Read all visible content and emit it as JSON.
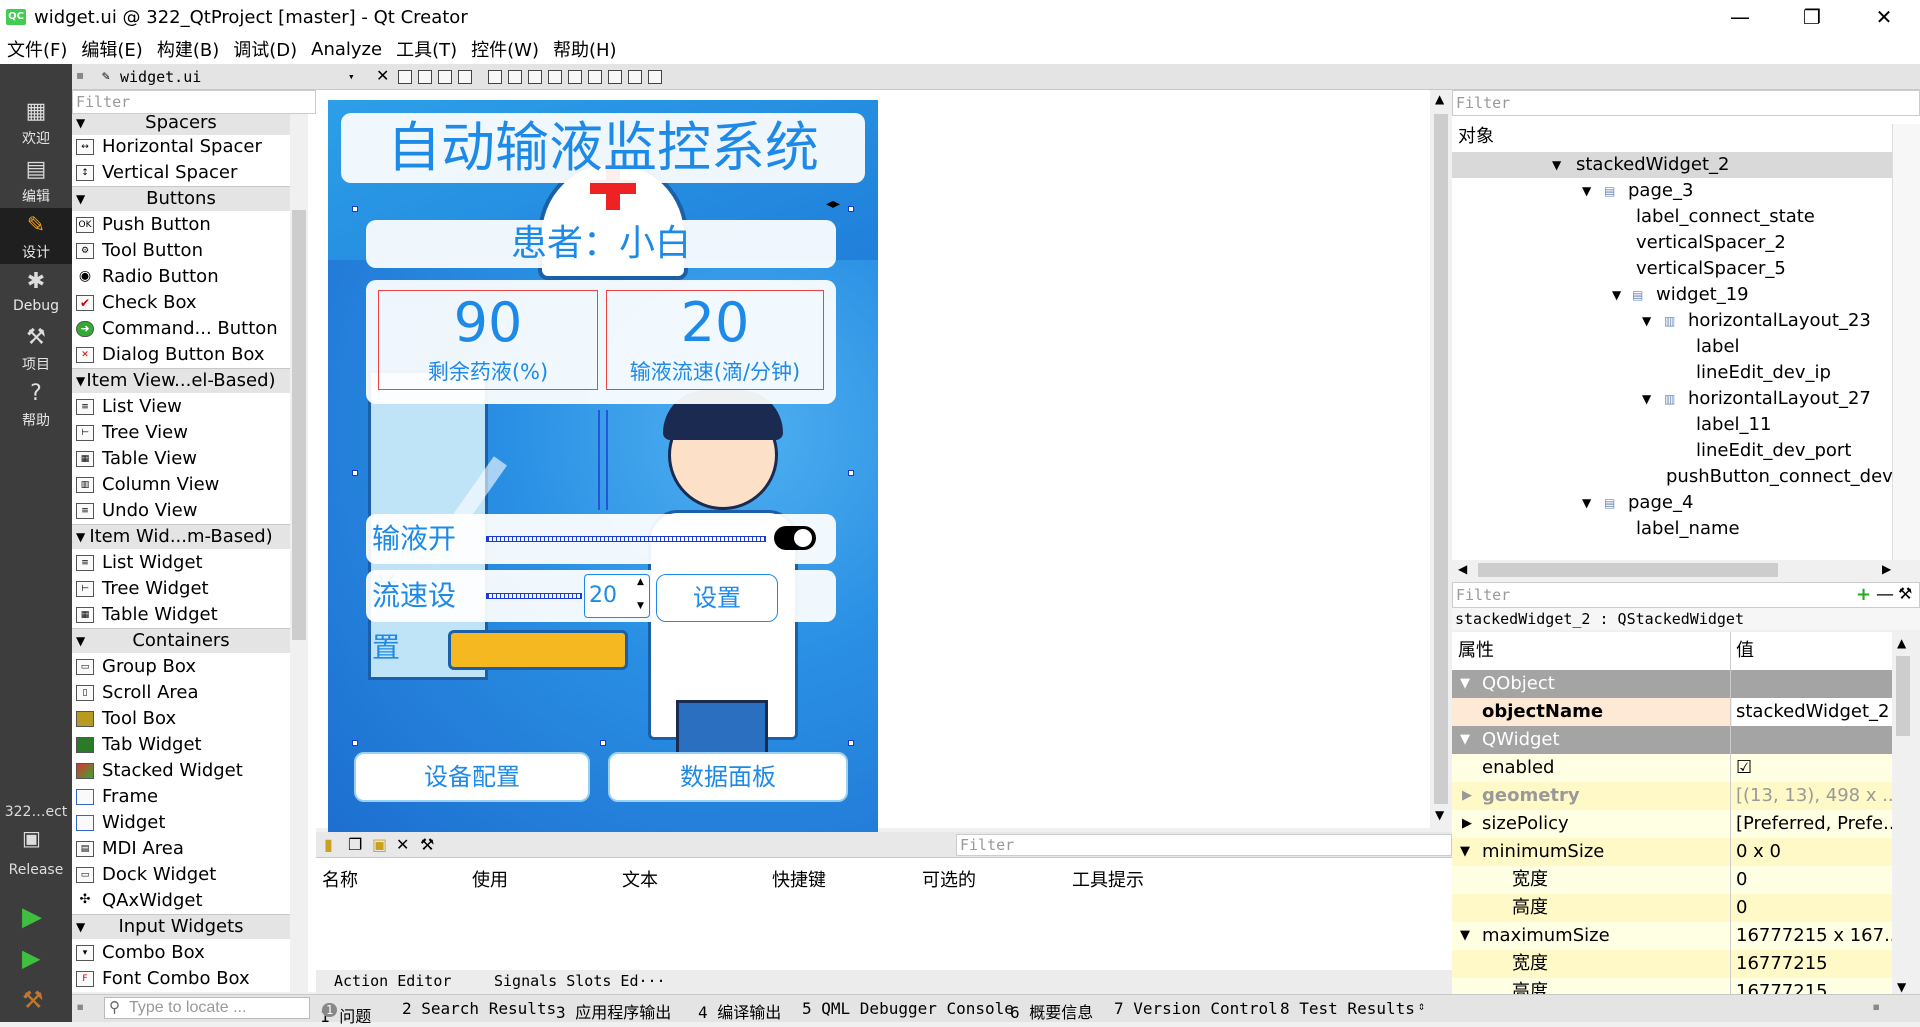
{
  "window": {
    "title": "widget.ui @ 322_QtProject [master] - Qt Creator",
    "app_icon": "QC"
  },
  "menubar": [
    "文件(F)",
    "编辑(E)",
    "构建(B)",
    "调试(D)",
    "Analyze",
    "工具(T)",
    "控件(W)",
    "帮助(H)"
  ],
  "modes": [
    "欢迎",
    "编辑",
    "设计",
    "Debug",
    "项目",
    "帮助"
  ],
  "kit": {
    "project": "322…ect",
    "config": "Release"
  },
  "editor_tab": "widget.ui",
  "widgetbox": {
    "filter_placeholder": "Filter",
    "categories": {
      "spacers": "Spacers",
      "buttons": "Buttons",
      "item_views": "Item View...el-Based)",
      "item_widgets": "Item Wid...m-Based)",
      "containers": "Containers",
      "input_widgets": "Input Widgets"
    },
    "items": {
      "horizontal_spacer": "Horizontal Spacer",
      "vertical_spacer": "Vertical Spacer",
      "push_button": "Push Button",
      "tool_button": "Tool Button",
      "radio_button": "Radio Button",
      "check_box": "Check Box",
      "command_button": "Command... Button",
      "dialog_button_box": "Dialog Button Box",
      "list_view": "List View",
      "tree_view": "Tree View",
      "table_view": "Table View",
      "column_view": "Column View",
      "undo_view": "Undo View",
      "list_widget": "List Widget",
      "tree_widget": "Tree Widget",
      "table_widget": "Table Widget",
      "group_box": "Group Box",
      "scroll_area": "Scroll Area",
      "tool_box": "Tool Box",
      "tab_widget": "Tab Widget",
      "stacked_widget": "Stacked Widget",
      "frame": "Frame",
      "widget": "Widget",
      "mdi_area": "MDI Area",
      "dock_widget": "Dock Widget",
      "qaxwidget": "QAxWidget",
      "combo_box": "Combo Box",
      "font_combo_box": "Font Combo Box"
    }
  },
  "form": {
    "title": "自动输液监控系统",
    "patient": "患者：小白",
    "remaining_value": "90",
    "remaining_label": "剩余药液(%)",
    "flow_value": "20",
    "flow_label": "输液流速(滴/分钟)",
    "switch_label": "输液开关",
    "speed_label": "流速设置",
    "speed_spin": "20",
    "set_button": "设置",
    "device_button": "设备配置",
    "data_button": "数据面板"
  },
  "object_inspector": {
    "filter_placeholder": "Filter",
    "header": "对象",
    "rows": {
      "r0": "stackedWidget_2",
      "r1": "page_3",
      "r2": "label_connect_state",
      "r3": "verticalSpacer_2",
      "r4": "verticalSpacer_5",
      "r5": "widget_19",
      "r6": "horizontalLayout_23",
      "r7": "label",
      "r8": "lineEdit_dev_ip",
      "r9": "horizontalLayout_27",
      "r10": "label_11",
      "r11": "lineEdit_dev_port",
      "r12": "pushButton_connect_dev",
      "r13": "page_4",
      "r14": "label_name"
    }
  },
  "property_editor": {
    "filter_placeholder": "Filter",
    "class_line": "stackedWidget_2 : QStackedWidget",
    "col_property": "属性",
    "col_value": "值",
    "rows": {
      "qobject": "QObject",
      "objectname_name": "objectName",
      "objectname_value": "stackedWidget_2",
      "qwidget": "QWidget",
      "enabled_name": "enabled",
      "enabled_value": "☑",
      "geometry_name": "geometry",
      "geometry_value": "[(13, 13), 498 x ...",
      "sizepolicy_name": "sizePolicy",
      "sizepolicy_value": "[Preferred, Prefe...",
      "minsize_name": "minimumSize",
      "minsize_value": "0 x 0",
      "width_name": "宽度",
      "width_value": "0",
      "height_name": "高度",
      "height_value": "0",
      "maxsize_name": "maximumSize",
      "maxsize_value": "16777215 x 167...",
      "maxwidth_name": "宽度",
      "maxwidth_value": "16777215",
      "maxheight_name": "高度",
      "maxheight_value": "16777215"
    }
  },
  "action_editor": {
    "filter_placeholder": "Filter",
    "columns": [
      "名称",
      "使用",
      "文本",
      "快捷键",
      "可选的",
      "工具提示"
    ],
    "tabs": [
      "Action Editor",
      "Signals Slots Ed···"
    ]
  },
  "statusbar": {
    "locator_placeholder": "Type to locate ...",
    "panes": [
      "1 问题",
      "2 Search Results",
      "3 应用程序输出",
      "4 编译输出",
      "5 QML Debugger Console",
      "6 概要信息",
      "7 Version Control",
      "8 Test Results"
    ],
    "issues_badge": "1"
  },
  "colors": {
    "accent_blue": "#1e8ae8",
    "mode_bar": "#3d3d3d",
    "section_gray": "#a4a4a4"
  }
}
